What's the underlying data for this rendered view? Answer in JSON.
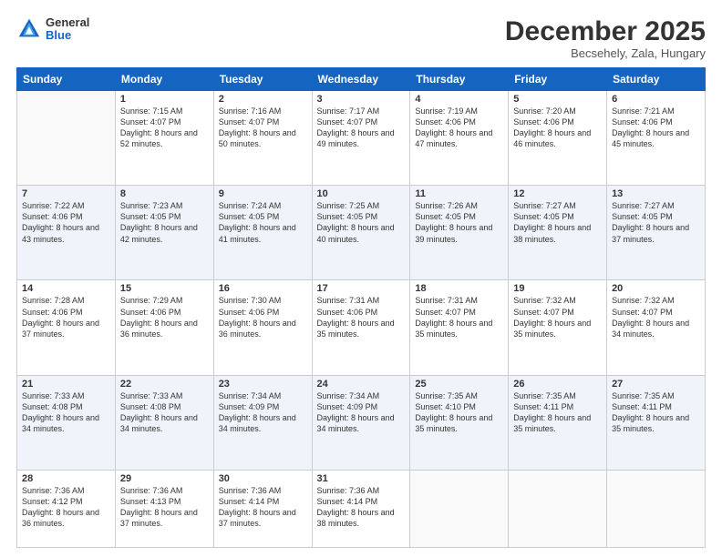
{
  "logo": {
    "general": "General",
    "blue": "Blue"
  },
  "header": {
    "month": "December 2025",
    "location": "Becsehely, Zala, Hungary"
  },
  "days_of_week": [
    "Sunday",
    "Monday",
    "Tuesday",
    "Wednesday",
    "Thursday",
    "Friday",
    "Saturday"
  ],
  "weeks": [
    [
      {
        "num": "",
        "sunrise": "",
        "sunset": "",
        "daylight": "",
        "empty": true
      },
      {
        "num": "1",
        "sunrise": "Sunrise: 7:15 AM",
        "sunset": "Sunset: 4:07 PM",
        "daylight": "Daylight: 8 hours and 52 minutes."
      },
      {
        "num": "2",
        "sunrise": "Sunrise: 7:16 AM",
        "sunset": "Sunset: 4:07 PM",
        "daylight": "Daylight: 8 hours and 50 minutes."
      },
      {
        "num": "3",
        "sunrise": "Sunrise: 7:17 AM",
        "sunset": "Sunset: 4:07 PM",
        "daylight": "Daylight: 8 hours and 49 minutes."
      },
      {
        "num": "4",
        "sunrise": "Sunrise: 7:19 AM",
        "sunset": "Sunset: 4:06 PM",
        "daylight": "Daylight: 8 hours and 47 minutes."
      },
      {
        "num": "5",
        "sunrise": "Sunrise: 7:20 AM",
        "sunset": "Sunset: 4:06 PM",
        "daylight": "Daylight: 8 hours and 46 minutes."
      },
      {
        "num": "6",
        "sunrise": "Sunrise: 7:21 AM",
        "sunset": "Sunset: 4:06 PM",
        "daylight": "Daylight: 8 hours and 45 minutes."
      }
    ],
    [
      {
        "num": "7",
        "sunrise": "Sunrise: 7:22 AM",
        "sunset": "Sunset: 4:06 PM",
        "daylight": "Daylight: 8 hours and 43 minutes."
      },
      {
        "num": "8",
        "sunrise": "Sunrise: 7:23 AM",
        "sunset": "Sunset: 4:05 PM",
        "daylight": "Daylight: 8 hours and 42 minutes."
      },
      {
        "num": "9",
        "sunrise": "Sunrise: 7:24 AM",
        "sunset": "Sunset: 4:05 PM",
        "daylight": "Daylight: 8 hours and 41 minutes."
      },
      {
        "num": "10",
        "sunrise": "Sunrise: 7:25 AM",
        "sunset": "Sunset: 4:05 PM",
        "daylight": "Daylight: 8 hours and 40 minutes."
      },
      {
        "num": "11",
        "sunrise": "Sunrise: 7:26 AM",
        "sunset": "Sunset: 4:05 PM",
        "daylight": "Daylight: 8 hours and 39 minutes."
      },
      {
        "num": "12",
        "sunrise": "Sunrise: 7:27 AM",
        "sunset": "Sunset: 4:05 PM",
        "daylight": "Daylight: 8 hours and 38 minutes."
      },
      {
        "num": "13",
        "sunrise": "Sunrise: 7:27 AM",
        "sunset": "Sunset: 4:05 PM",
        "daylight": "Daylight: 8 hours and 37 minutes."
      }
    ],
    [
      {
        "num": "14",
        "sunrise": "Sunrise: 7:28 AM",
        "sunset": "Sunset: 4:06 PM",
        "daylight": "Daylight: 8 hours and 37 minutes."
      },
      {
        "num": "15",
        "sunrise": "Sunrise: 7:29 AM",
        "sunset": "Sunset: 4:06 PM",
        "daylight": "Daylight: 8 hours and 36 minutes."
      },
      {
        "num": "16",
        "sunrise": "Sunrise: 7:30 AM",
        "sunset": "Sunset: 4:06 PM",
        "daylight": "Daylight: 8 hours and 36 minutes."
      },
      {
        "num": "17",
        "sunrise": "Sunrise: 7:31 AM",
        "sunset": "Sunset: 4:06 PM",
        "daylight": "Daylight: 8 hours and 35 minutes."
      },
      {
        "num": "18",
        "sunrise": "Sunrise: 7:31 AM",
        "sunset": "Sunset: 4:07 PM",
        "daylight": "Daylight: 8 hours and 35 minutes."
      },
      {
        "num": "19",
        "sunrise": "Sunrise: 7:32 AM",
        "sunset": "Sunset: 4:07 PM",
        "daylight": "Daylight: 8 hours and 35 minutes."
      },
      {
        "num": "20",
        "sunrise": "Sunrise: 7:32 AM",
        "sunset": "Sunset: 4:07 PM",
        "daylight": "Daylight: 8 hours and 34 minutes."
      }
    ],
    [
      {
        "num": "21",
        "sunrise": "Sunrise: 7:33 AM",
        "sunset": "Sunset: 4:08 PM",
        "daylight": "Daylight: 8 hours and 34 minutes."
      },
      {
        "num": "22",
        "sunrise": "Sunrise: 7:33 AM",
        "sunset": "Sunset: 4:08 PM",
        "daylight": "Daylight: 8 hours and 34 minutes."
      },
      {
        "num": "23",
        "sunrise": "Sunrise: 7:34 AM",
        "sunset": "Sunset: 4:09 PM",
        "daylight": "Daylight: 8 hours and 34 minutes."
      },
      {
        "num": "24",
        "sunrise": "Sunrise: 7:34 AM",
        "sunset": "Sunset: 4:09 PM",
        "daylight": "Daylight: 8 hours and 34 minutes."
      },
      {
        "num": "25",
        "sunrise": "Sunrise: 7:35 AM",
        "sunset": "Sunset: 4:10 PM",
        "daylight": "Daylight: 8 hours and 35 minutes."
      },
      {
        "num": "26",
        "sunrise": "Sunrise: 7:35 AM",
        "sunset": "Sunset: 4:11 PM",
        "daylight": "Daylight: 8 hours and 35 minutes."
      },
      {
        "num": "27",
        "sunrise": "Sunrise: 7:35 AM",
        "sunset": "Sunset: 4:11 PM",
        "daylight": "Daylight: 8 hours and 35 minutes."
      }
    ],
    [
      {
        "num": "28",
        "sunrise": "Sunrise: 7:36 AM",
        "sunset": "Sunset: 4:12 PM",
        "daylight": "Daylight: 8 hours and 36 minutes."
      },
      {
        "num": "29",
        "sunrise": "Sunrise: 7:36 AM",
        "sunset": "Sunset: 4:13 PM",
        "daylight": "Daylight: 8 hours and 37 minutes."
      },
      {
        "num": "30",
        "sunrise": "Sunrise: 7:36 AM",
        "sunset": "Sunset: 4:14 PM",
        "daylight": "Daylight: 8 hours and 37 minutes."
      },
      {
        "num": "31",
        "sunrise": "Sunrise: 7:36 AM",
        "sunset": "Sunset: 4:14 PM",
        "daylight": "Daylight: 8 hours and 38 minutes."
      },
      {
        "num": "",
        "sunrise": "",
        "sunset": "",
        "daylight": "",
        "empty": true
      },
      {
        "num": "",
        "sunrise": "",
        "sunset": "",
        "daylight": "",
        "empty": true
      },
      {
        "num": "",
        "sunrise": "",
        "sunset": "",
        "daylight": "",
        "empty": true
      }
    ]
  ]
}
